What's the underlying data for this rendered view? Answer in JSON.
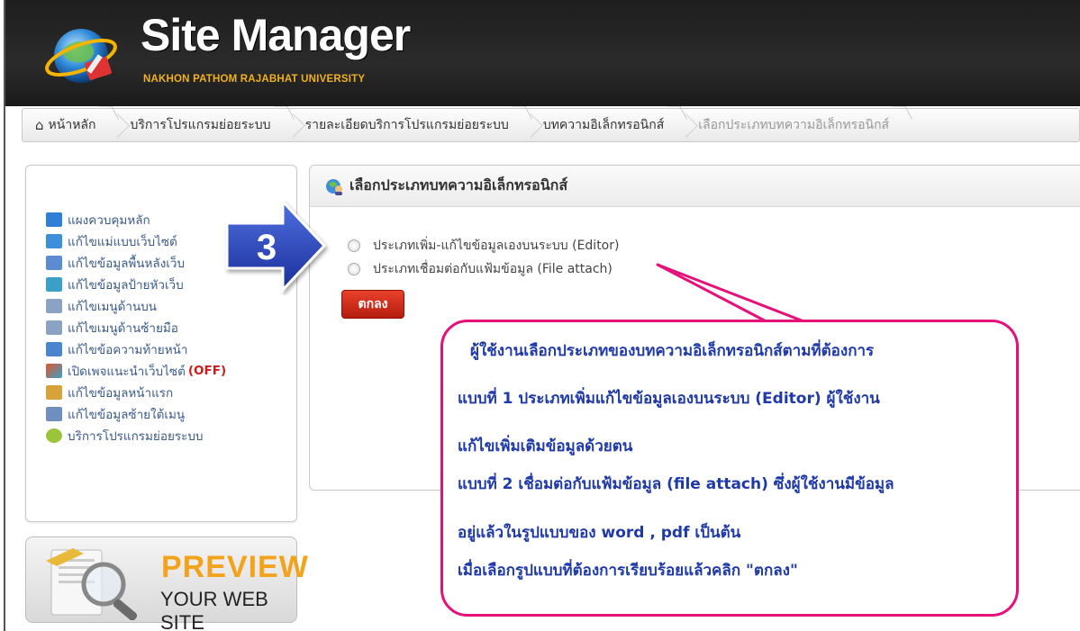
{
  "header": {
    "title": "Site Manager",
    "subtitle": "NAKHON PATHOM RAJABHAT UNIVERSITY"
  },
  "breadcrumb": {
    "items": [
      {
        "label": "หน้าหลัก",
        "icon": "home-icon"
      },
      {
        "label": "บริการโปรแกรมย่อยระบบ"
      },
      {
        "label": "รายละเอียดบริการโปรแกรมย่อยระบบ"
      },
      {
        "label": "บทความอิเล็กทรอนิกส์"
      },
      {
        "label": "เลือกประเภทบทความอิเล็กทรอนิกส์"
      }
    ]
  },
  "sidebar": {
    "items": [
      {
        "label": "แผงควบคุมหลัก",
        "icon": "dashboard-icon",
        "color": "#2f7fd6"
      },
      {
        "label": "แก้ไขแม่แบบเว็บไซต์",
        "icon": "template-icon",
        "color": "#3d8fd9"
      },
      {
        "label": "แก้ไขข้อมูลพื้นหลังเว็บ",
        "icon": "background-icon",
        "color": "#5b8bd0"
      },
      {
        "label": "แก้ไขข้อมูลป้ายหัวเว็บ",
        "icon": "banner-icon",
        "color": "#3aa0c8"
      },
      {
        "label": "แก้ไขเมนูด้านบน",
        "icon": "top-menu-icon",
        "color": "#8aa3c4"
      },
      {
        "label": "แก้ไขเมนูด้านซ้ายมือ",
        "icon": "left-menu-icon",
        "color": "#8aa3c4"
      },
      {
        "label": "แก้ไขข้อความท้ายหน้า",
        "icon": "footer-icon",
        "color": "#4a86cf"
      },
      {
        "label": "เปิดเพจแนะนำเว็บไซต์",
        "icon": "intro-page-icon",
        "color": "#e0562a",
        "status": "(OFF)"
      },
      {
        "label": "แก้ไขข้อมูลหน้าแรก",
        "icon": "home-page-icon",
        "color": "#d8a23a"
      },
      {
        "label": "แก้ไขข้อมูลซ้ายใต้เมนู",
        "icon": "left-under-menu-icon",
        "color": "#6f8fbf"
      },
      {
        "label": "บริการโปรแกรมย่อยระบบ",
        "icon": "subprogram-icon",
        "color": "#9ac43a"
      }
    ]
  },
  "preview": {
    "title": "PREVIEW",
    "subtitle": "YOUR WEB SITE"
  },
  "panel": {
    "title": "เลือกประเภทบทความอิเล็กทรอนิกส์",
    "options": [
      "ประเภทเพิ่ม-แก้ไขข้อมูลเองบนระบบ (Editor)",
      "ประเภทเชื่อมต่อกับแฟ้มข้อมูล (File attach)"
    ],
    "submit_label": "ตกลง"
  },
  "step_marker": "3",
  "callout": {
    "lines": [
      "ผู้ใช้งานเลือกประเภทของบทความอิเล็กทรอนิกส์ตามที่ต้องการ",
      "แบบที่ 1 ประเภทเพิ่มแก้ไขข้อมูลเองบนระบบ (Editor) ผู้ใช้งาน",
      "แก้ไขเพิ่มเติมข้อมูลด้วยตน",
      "แบบที่ 2 เชื่อมต่อกับแฟ้มข้อมูล (file attach) ซึ่งผู้ใช้งานมีข้อมูล",
      "อยู่แล้วในรูปแบบของ word , pdf เป็นต้น",
      "เมื่อเลือกรูปแบบที่ต้องการเรียบร้อยแล้วคลิก \"ตกลง\""
    ]
  },
  "colors": {
    "accent_red": "#c92412",
    "callout_border": "#e5107a",
    "callout_text": "#1f3aa8",
    "link_blue": "#3a5a8a",
    "status_off": "#d21a1a"
  }
}
